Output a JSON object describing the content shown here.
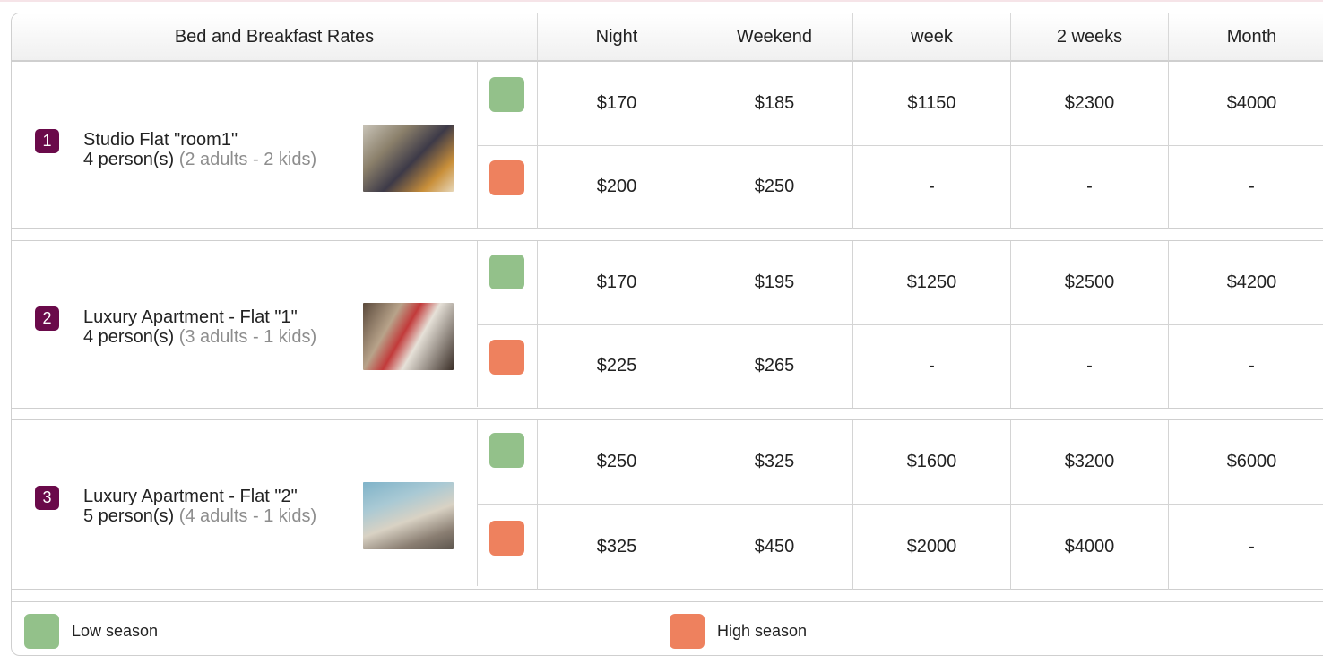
{
  "header": {
    "title": "Bed and Breakfast Rates",
    "columns": [
      "Night",
      "Weekend",
      "week",
      "2 weeks",
      "Month"
    ]
  },
  "rooms": [
    {
      "number": "1",
      "name": "Studio Flat \"room1\"",
      "capacity": "4 person(s)",
      "detail": "(2 adults - 2 kids)",
      "low": [
        "$170",
        "$185",
        "$1150",
        "$2300",
        "$4000"
      ],
      "high": [
        "$200",
        "$250",
        "-",
        "-",
        "-"
      ]
    },
    {
      "number": "2",
      "name": "Luxury Apartment - Flat \"1\"",
      "capacity": "4 person(s)",
      "detail": "(3 adults - 1 kids)",
      "low": [
        "$170",
        "$195",
        "$1250",
        "$2500",
        "$4200"
      ],
      "high": [
        "$225",
        "$265",
        "-",
        "-",
        "-"
      ]
    },
    {
      "number": "3",
      "name": "Luxury Apartment - Flat \"2\"",
      "capacity": "5 person(s)",
      "detail": "(4 adults - 1 kids)",
      "low": [
        "$250",
        "$325",
        "$1600",
        "$3200",
        "$6000"
      ],
      "high": [
        "$325",
        "$450",
        "$2000",
        "$4000",
        "-"
      ]
    }
  ],
  "legend": {
    "low_label": "Low season",
    "high_label": "High season"
  },
  "colors": {
    "low_season": "#93c18a",
    "high_season": "#ee815e",
    "badge": "#6a0a4a"
  }
}
